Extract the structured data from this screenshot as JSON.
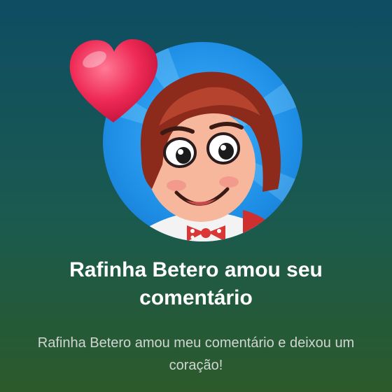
{
  "notification": {
    "title": "Rafinha Betero amou seu comentário",
    "message": "Rafinha Betero amou meu comentário e deixou um coração!"
  },
  "icons": {
    "avatar": "character-avatar",
    "reaction": "heart-icon"
  },
  "colors": {
    "background_top": "#0e4d63",
    "background_bottom": "#2c5a2a",
    "avatar_ring": "#1f8fe6",
    "heart": "#e8234a"
  }
}
